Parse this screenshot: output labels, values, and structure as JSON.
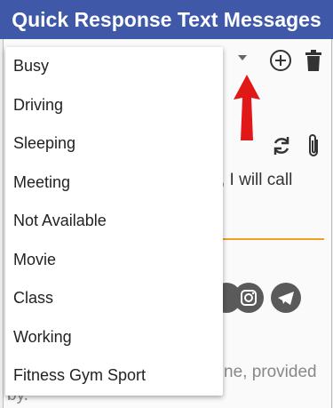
{
  "banner": {
    "title": "Quick Response Text Messages"
  },
  "behind": {
    "message_fragment": ", I will call",
    "footer_fragment": "ne, provided",
    "footer_fragment2": "by."
  },
  "dropdown": {
    "items": [
      {
        "label": "Busy"
      },
      {
        "label": "Driving"
      },
      {
        "label": "Sleeping"
      },
      {
        "label": "Meeting"
      },
      {
        "label": "Not Available"
      },
      {
        "label": "Movie"
      },
      {
        "label": "Class"
      },
      {
        "label": "Working"
      },
      {
        "label": "Fitness Gym Sport"
      }
    ]
  },
  "colors": {
    "banner": "#3f59a8",
    "arrow": "#e01818",
    "accent_underline": "#f0a020",
    "social_icon": "#5a5a5a"
  },
  "icons": [
    "dropdown-caret-icon",
    "add-circle-icon",
    "trash-icon",
    "red-pointer-arrow-icon",
    "refresh-icon",
    "paperclip-icon",
    "instagram-icon",
    "telegram-icon"
  ]
}
